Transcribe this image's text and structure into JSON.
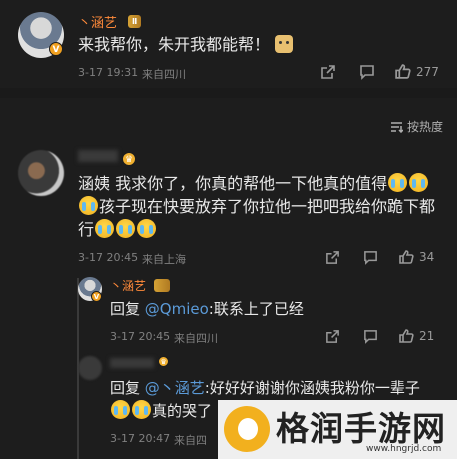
{
  "comment_top": {
    "username": "丶涵艺",
    "level_badge": "Ⅱ",
    "text": "来我帮你，朱开我都能帮！",
    "time": "3-17 19:31",
    "location": "来自四川",
    "like_count": "277"
  },
  "sort_label": "按热度",
  "comment_main": {
    "username": "",
    "text_line1": "涵姨 我求你了，你真的帮他一下他真的值得",
    "text_line2": "孩子现在快要放弃了你拉他一把吧我给你跪下都",
    "text_line3": "行",
    "time": "3-17 20:45",
    "location": "来自上海",
    "like_count": "34"
  },
  "reply_1": {
    "username": "丶涵艺",
    "prefix": "回复 ",
    "mention": "@Qmieo",
    "text": ":联系上了已经",
    "time": "3-17 20:45",
    "location": "来自四川",
    "like_count": "21"
  },
  "reply_2": {
    "prefix": "回复 ",
    "mention": "@丶涵艺",
    "text_line1": ":好好好谢谢你涵姨我粉你一辈子",
    "text_line2": "真的哭了",
    "time": "3-17 20:47",
    "location": "来自四"
  },
  "watermark": {
    "brand": "格润手游网",
    "url": "www.hngrjd.com"
  },
  "colors": {
    "background": "#1d1d1d",
    "username": "#ff8a3a",
    "mention": "#5b9ad7",
    "meta": "#808080"
  }
}
